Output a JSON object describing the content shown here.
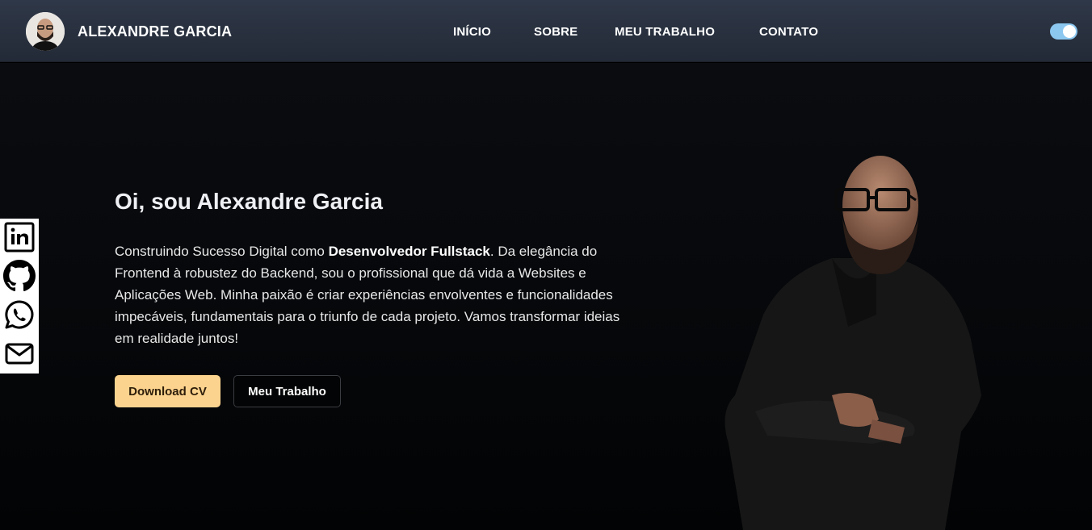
{
  "header": {
    "brand": "ALEXANDRE GARCIA",
    "nav": [
      {
        "label": "INÍCIO"
      },
      {
        "label": "SOBRE"
      },
      {
        "label": "MEU TRABALHO"
      },
      {
        "label": "CONTATO"
      }
    ],
    "theme_toggle": {
      "on": true
    }
  },
  "hero": {
    "title": "Oi, sou Alexandre Garcia",
    "text_before": "Construindo Sucesso Digital como ",
    "text_bold": "Desenvolvedor Fullstack",
    "text_after": ". Da elegância do Frontend à robustez do Backend, sou o profissional que dá vida a Websites e Aplicações Web. Minha paixão é criar experiências envolventes e funcionalidades impecáveis, fundamentais para o triunfo de cada projeto. Vamos transformar ideias em realidade juntos!",
    "primary_button": "Download CV",
    "secondary_button": "Meu Trabalho"
  },
  "social": [
    {
      "icon": "linkedin-icon"
    },
    {
      "icon": "github-icon"
    },
    {
      "icon": "whatsapp-icon"
    },
    {
      "icon": "mail-icon"
    }
  ],
  "colors": {
    "header_bg": "#2f3848",
    "page_bg": "#000000",
    "accent": "#fcd38e",
    "toggle": "#8cc7f0"
  }
}
